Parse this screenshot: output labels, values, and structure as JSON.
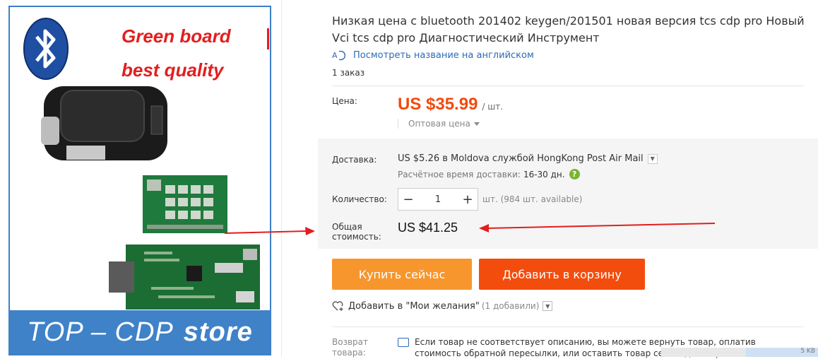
{
  "product_image": {
    "promo_line1": "Green board",
    "promo_line2": "best quality",
    "store_brand": "TOP – CDP",
    "store_word": "store"
  },
  "title": "Низкая цена с bluetooth 201402 keygen/201501 новая версия tcs cdp pro Новый Vci tcs cdp pro Диагностический Инструмент",
  "translate_link": "Посмотреть название на английском",
  "orders": "1 заказ",
  "price": {
    "label": "Цена:",
    "amount": "US $35.99",
    "unit": "/ шт.",
    "wholesale": "Оптовая цена"
  },
  "shipping": {
    "label": "Доставка:",
    "main": "US $5.26 в Moldova службой HongKong Post Air Mail",
    "sub_label": "Расчётное время доставки:",
    "days": "16-30 дн."
  },
  "quantity": {
    "label": "Количество:",
    "value": "1",
    "minus": "−",
    "plus": "+",
    "note": "шт. (984 шт. available)"
  },
  "total": {
    "label_line1": "Общая",
    "label_line2": "стоимость:",
    "amount": "US $41.25"
  },
  "buttons": {
    "buy": "Купить сейчас",
    "cart": "Добавить в корзину"
  },
  "wishlist": {
    "label": "Добавить в \"Мои желания\"",
    "count": "(1 добавили)"
  },
  "returns": {
    "label_line1": "Возврат",
    "label_line2": "товара:",
    "text": "Если товар не соответствует описанию, вы можете вернуть товар, оплатив стоимость обратной пересылки, или оставить товар себе и договор"
  },
  "load_indicator": "5 KB",
  "colors": {
    "price": "#f24a0d",
    "buy_button": "#f7962c",
    "cart_button": "#f34d0d",
    "link": "#2d6ab5",
    "banner": "#3f82c8",
    "annotation_arrow": "#e21e1e"
  }
}
